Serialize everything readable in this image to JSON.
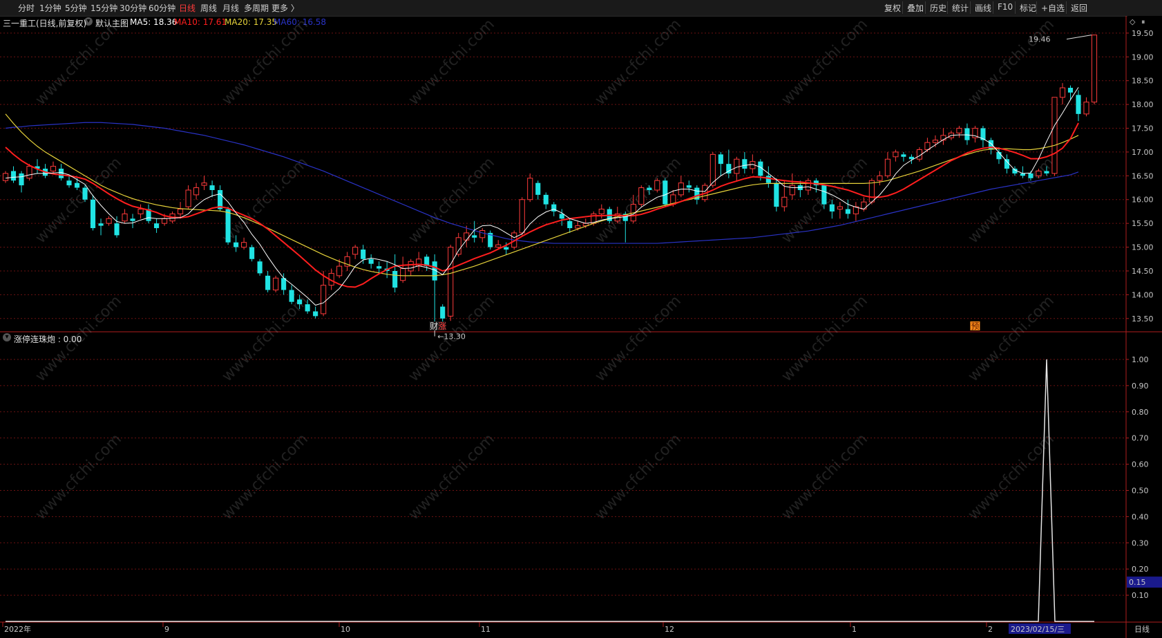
{
  "toolbar": {
    "left_items": [
      "分时",
      "1分钟",
      "5分钟",
      "15分钟",
      "30分钟",
      "60分钟",
      "日线",
      "周线",
      "月线",
      "多周期",
      "更多 〉"
    ],
    "active_item": "日线",
    "right_items": [
      "复权",
      "叠加",
      "历史",
      "统计",
      "画线",
      "F10",
      "标记",
      "+自选",
      "返回"
    ]
  },
  "main_header": {
    "stock": "三一重工(日线,前复权)",
    "template": "默认主图",
    "ma5": "MA5: 18.36",
    "ma10": "MA10: 17.61",
    "ma20": "MA20: 17.35",
    "ma60": "MA60: 16.58"
  },
  "indicator_header": {
    "label": "涨停连珠炮 : 0.00"
  },
  "price_axis": {
    "ticks": [
      "19.50",
      "19.00",
      "18.50",
      "18.00",
      "17.50",
      "17.00",
      "16.50",
      "16.00",
      "15.50",
      "15.00",
      "14.50",
      "14.00",
      "13.50"
    ]
  },
  "indicator_axis": {
    "ticks": [
      "1.00",
      "0.90",
      "0.80",
      "0.70",
      "0.60",
      "0.50",
      "0.40",
      "0.30",
      "0.20",
      "0.10"
    ],
    "current_value_badge": "0.15"
  },
  "time_axis": {
    "labels": [
      "2022年",
      "9",
      "10",
      "11",
      "12",
      "1",
      "2"
    ],
    "cursor_date": "2023/02/15/三",
    "period": "日线"
  },
  "annotations": {
    "high_label": "19.46",
    "low_label": "13.30",
    "event_cai": "财",
    "event_zhang": "涨",
    "event_yu": "预"
  },
  "watermark": "www.cfchi.com",
  "colors": {
    "up": "#ff3b3b",
    "down": "#20e3e3",
    "ma5": "#ffffff",
    "ma10": "#ff1e1e",
    "ma20": "#e6d23a",
    "ma60": "#2a33c8",
    "grid": "#6e1212",
    "axis_border": "#b01e1e"
  },
  "chart_data": {
    "type": "candlestick",
    "price_ylim": [
      13.25,
      19.6
    ],
    "indicator_ylim": [
      0,
      1.05
    ],
    "high": 19.46,
    "low": 13.3,
    "candles": [
      [
        16.4,
        16.55,
        16.35,
        16.6
      ],
      [
        16.6,
        16.4,
        16.35,
        16.7
      ],
      [
        16.55,
        16.3,
        16.15,
        16.6
      ],
      [
        16.45,
        16.7,
        16.4,
        16.75
      ],
      [
        16.7,
        16.65,
        16.55,
        16.85
      ],
      [
        16.65,
        16.5,
        16.45,
        16.75
      ],
      [
        16.6,
        16.7,
        16.55,
        16.8
      ],
      [
        16.65,
        16.45,
        16.4,
        16.75
      ],
      [
        16.4,
        16.3,
        16.25,
        16.5
      ],
      [
        16.35,
        16.25,
        16.2,
        16.45
      ],
      [
        16.25,
        16.0,
        15.95,
        16.3
      ],
      [
        16.0,
        15.4,
        15.35,
        16.1
      ],
      [
        15.5,
        15.45,
        15.25,
        15.6
      ],
      [
        15.5,
        15.6,
        15.45,
        15.65
      ],
      [
        15.5,
        15.25,
        15.2,
        15.65
      ],
      [
        15.55,
        15.7,
        15.5,
        15.8
      ],
      [
        15.6,
        15.55,
        15.4,
        15.7
      ],
      [
        15.7,
        15.8,
        15.6,
        15.9
      ],
      [
        15.8,
        15.55,
        15.5,
        15.9
      ],
      [
        15.5,
        15.4,
        15.3,
        15.6
      ],
      [
        15.5,
        15.6,
        15.45,
        15.7
      ],
      [
        15.55,
        15.7,
        15.5,
        15.75
      ],
      [
        15.7,
        15.8,
        15.6,
        15.95
      ],
      [
        15.85,
        16.2,
        15.8,
        16.3
      ],
      [
        16.1,
        16.25,
        16.0,
        16.35
      ],
      [
        16.3,
        16.35,
        16.2,
        16.5
      ],
      [
        16.3,
        16.2,
        16.05,
        16.4
      ],
      [
        16.2,
        15.8,
        15.75,
        16.3
      ],
      [
        15.8,
        15.1,
        15.05,
        15.85
      ],
      [
        15.1,
        15.0,
        14.9,
        15.25
      ],
      [
        15.0,
        15.1,
        14.95,
        15.2
      ],
      [
        15.0,
        14.75,
        14.7,
        15.05
      ],
      [
        14.7,
        14.45,
        14.4,
        14.75
      ],
      [
        14.4,
        14.1,
        14.05,
        14.5
      ],
      [
        14.1,
        14.35,
        14.05,
        14.4
      ],
      [
        14.35,
        14.1,
        14.0,
        14.45
      ],
      [
        14.1,
        13.85,
        13.8,
        14.2
      ],
      [
        13.9,
        13.8,
        13.7,
        14.0
      ],
      [
        13.8,
        13.65,
        13.6,
        13.9
      ],
      [
        13.65,
        13.55,
        13.5,
        13.75
      ],
      [
        13.6,
        14.2,
        13.55,
        14.5
      ],
      [
        14.2,
        14.45,
        14.1,
        14.55
      ],
      [
        14.4,
        14.6,
        14.35,
        14.75
      ],
      [
        14.6,
        14.8,
        14.5,
        14.9
      ],
      [
        14.85,
        15.0,
        14.75,
        15.05
      ],
      [
        14.95,
        14.75,
        14.65,
        15.05
      ],
      [
        14.75,
        14.65,
        14.55,
        14.85
      ],
      [
        14.6,
        14.55,
        14.45,
        14.7
      ],
      [
        14.55,
        14.5,
        14.35,
        14.7
      ],
      [
        14.5,
        14.15,
        14.05,
        14.85
      ],
      [
        14.3,
        14.55,
        14.25,
        14.8
      ],
      [
        14.5,
        14.7,
        14.4,
        14.75
      ],
      [
        14.6,
        14.75,
        14.5,
        14.9
      ],
      [
        14.8,
        14.6,
        14.5,
        14.85
      ],
      [
        14.7,
        14.3,
        13.3,
        14.85
      ],
      [
        13.75,
        13.5,
        13.3,
        13.8
      ],
      [
        13.55,
        15.0,
        13.45,
        15.05
      ],
      [
        14.85,
        15.2,
        14.8,
        15.3
      ],
      [
        15.15,
        15.3,
        15.0,
        15.45
      ],
      [
        15.25,
        15.2,
        15.1,
        15.55
      ],
      [
        15.2,
        15.35,
        15.1,
        15.4
      ],
      [
        15.3,
        15.0,
        14.95,
        15.35
      ],
      [
        15.0,
        15.05,
        14.95,
        15.15
      ],
      [
        15.0,
        14.95,
        14.85,
        15.1
      ],
      [
        15.0,
        15.3,
        14.95,
        15.35
      ],
      [
        15.3,
        16.0,
        15.25,
        16.05
      ],
      [
        16.0,
        16.45,
        15.95,
        16.55
      ],
      [
        16.35,
        16.1,
        16.0,
        16.4
      ],
      [
        16.1,
        15.9,
        15.8,
        16.15
      ],
      [
        15.9,
        15.75,
        15.65,
        15.95
      ],
      [
        15.7,
        15.6,
        15.45,
        15.8
      ],
      [
        15.55,
        15.4,
        15.3,
        15.6
      ],
      [
        15.4,
        15.45,
        15.35,
        15.55
      ],
      [
        15.45,
        15.5,
        15.4,
        15.6
      ],
      [
        15.5,
        15.7,
        15.45,
        15.75
      ],
      [
        15.7,
        15.8,
        15.6,
        15.9
      ],
      [
        15.8,
        15.55,
        15.5,
        15.85
      ],
      [
        15.55,
        15.7,
        15.5,
        15.85
      ],
      [
        15.7,
        15.55,
        15.1,
        15.75
      ],
      [
        15.55,
        15.9,
        15.5,
        16.1
      ],
      [
        15.9,
        16.25,
        15.85,
        16.3
      ],
      [
        16.25,
        16.2,
        16.1,
        16.3
      ],
      [
        16.2,
        16.4,
        16.15,
        16.45
      ],
      [
        16.4,
        15.9,
        15.85,
        16.45
      ],
      [
        15.9,
        16.1,
        15.85,
        16.2
      ],
      [
        16.1,
        16.35,
        16.05,
        16.5
      ],
      [
        16.3,
        16.25,
        16.15,
        16.4
      ],
      [
        16.25,
        16.0,
        15.9,
        16.3
      ],
      [
        16.0,
        16.3,
        15.95,
        16.35
      ],
      [
        16.3,
        16.95,
        16.25,
        17.0
      ],
      [
        16.95,
        16.75,
        16.5,
        17.0
      ],
      [
        16.75,
        16.55,
        16.45,
        17.05
      ],
      [
        16.55,
        16.85,
        16.4,
        16.9
      ],
      [
        16.85,
        16.65,
        16.55,
        17.0
      ],
      [
        16.65,
        16.8,
        16.55,
        16.95
      ],
      [
        16.8,
        16.5,
        16.4,
        16.85
      ],
      [
        16.5,
        16.35,
        16.25,
        16.7
      ],
      [
        16.35,
        15.85,
        15.75,
        16.45
      ],
      [
        15.85,
        16.05,
        15.75,
        16.4
      ],
      [
        16.1,
        16.3,
        16.0,
        16.55
      ],
      [
        16.3,
        16.2,
        16.05,
        16.4
      ],
      [
        16.2,
        16.4,
        16.1,
        16.45
      ],
      [
        16.4,
        16.3,
        16.15,
        16.45
      ],
      [
        16.3,
        15.9,
        15.8,
        16.3
      ],
      [
        15.9,
        15.75,
        15.6,
        16.0
      ],
      [
        15.8,
        15.85,
        15.6,
        15.95
      ],
      [
        15.8,
        15.7,
        15.6,
        16.0
      ],
      [
        15.7,
        15.85,
        15.55,
        15.95
      ],
      [
        15.8,
        15.95,
        15.75,
        16.05
      ],
      [
        15.95,
        16.4,
        15.9,
        16.45
      ],
      [
        16.4,
        16.5,
        16.3,
        16.6
      ],
      [
        16.5,
        16.85,
        16.45,
        17.0
      ],
      [
        16.9,
        17.0,
        16.8,
        17.05
      ],
      [
        16.95,
        16.9,
        16.8,
        17.0
      ],
      [
        16.9,
        16.85,
        16.75,
        16.95
      ],
      [
        16.85,
        17.05,
        16.8,
        17.1
      ],
      [
        17.05,
        17.2,
        17.0,
        17.3
      ],
      [
        17.2,
        17.25,
        17.1,
        17.35
      ],
      [
        17.25,
        17.35,
        17.15,
        17.5
      ],
      [
        17.3,
        17.4,
        17.25,
        17.45
      ],
      [
        17.4,
        17.5,
        17.3,
        17.55
      ],
      [
        17.5,
        17.25,
        17.15,
        17.6
      ],
      [
        17.3,
        17.5,
        17.2,
        17.55
      ],
      [
        17.5,
        17.25,
        17.1,
        17.55
      ],
      [
        17.25,
        17.05,
        16.95,
        17.3
      ],
      [
        17.0,
        16.85,
        16.75,
        17.1
      ],
      [
        16.85,
        16.65,
        16.55,
        16.95
      ],
      [
        16.65,
        16.55,
        16.5,
        16.7
      ],
      [
        16.55,
        16.5,
        16.45,
        16.7
      ],
      [
        16.55,
        16.45,
        16.4,
        16.6
      ],
      [
        16.5,
        16.6,
        16.45,
        16.65
      ],
      [
        16.6,
        16.55,
        16.5,
        16.7
      ],
      [
        16.55,
        18.15,
        16.5,
        18.15
      ],
      [
        18.15,
        18.35,
        18.0,
        18.45
      ],
      [
        18.35,
        18.25,
        18.1,
        18.4
      ],
      [
        18.2,
        17.8,
        17.65,
        18.3
      ],
      [
        17.8,
        18.05,
        17.75,
        18.15
      ],
      [
        18.05,
        19.46,
        18.0,
        19.46
      ]
    ],
    "ma5": [
      16.45,
      16.47,
      16.48,
      16.52,
      16.55,
      16.55,
      16.56,
      16.57,
      16.52,
      16.42,
      16.32,
      16.08,
      15.88,
      15.7,
      15.54,
      15.5,
      15.51,
      15.57,
      15.62,
      15.6,
      15.6,
      15.61,
      15.62,
      15.7,
      15.87,
      16.0,
      16.08,
      16.12,
      15.95,
      15.72,
      15.52,
      15.27,
      15.06,
      14.8,
      14.56,
      14.35,
      14.22,
      14.08,
      13.94,
      13.78,
      13.83,
      13.98,
      14.13,
      14.35,
      14.6,
      14.73,
      14.77,
      14.74,
      14.7,
      14.63,
      14.55,
      14.56,
      14.61,
      14.57,
      14.52,
      14.42,
      14.64,
      14.93,
      15.15,
      15.36,
      15.45,
      15.46,
      15.4,
      15.3,
      15.2,
      15.28,
      15.49,
      15.64,
      15.74,
      15.8,
      15.72,
      15.6,
      15.55,
      15.5,
      15.52,
      15.57,
      15.6,
      15.62,
      15.64,
      15.69,
      15.84,
      15.95,
      16.05,
      16.1,
      16.18,
      16.22,
      16.22,
      16.18,
      16.17,
      16.36,
      16.5,
      16.6,
      16.68,
      16.72,
      16.74,
      16.68,
      16.55,
      16.42,
      16.28,
      16.25,
      16.25,
      16.27,
      16.22,
      16.17,
      16.1,
      16.01,
      15.9,
      15.84,
      15.8,
      15.95,
      16.1,
      16.3,
      16.54,
      16.72,
      16.83,
      16.92,
      17.04,
      17.15,
      17.26,
      17.35,
      17.36,
      17.36,
      17.34,
      17.28,
      17.18,
      16.99,
      16.8,
      16.62,
      16.55,
      16.56,
      16.86,
      17.22,
      17.56,
      17.82,
      18.1,
      18.36
    ],
    "ma10": [
      17.1,
      16.95,
      16.82,
      16.72,
      16.64,
      16.58,
      16.54,
      16.52,
      16.5,
      16.47,
      16.43,
      16.34,
      16.23,
      16.12,
      16.02,
      15.93,
      15.86,
      15.82,
      15.78,
      15.73,
      15.66,
      15.63,
      15.62,
      15.64,
      15.7,
      15.76,
      15.82,
      15.85,
      15.82,
      15.74,
      15.67,
      15.6,
      15.5,
      15.38,
      15.24,
      15.1,
      14.96,
      14.82,
      14.67,
      14.52,
      14.4,
      14.3,
      14.22,
      14.17,
      14.16,
      14.23,
      14.34,
      14.44,
      14.53,
      14.6,
      14.62,
      14.63,
      14.64,
      14.62,
      14.58,
      14.5,
      14.55,
      14.62,
      14.69,
      14.76,
      14.82,
      14.88,
      14.96,
      15.04,
      15.13,
      15.23,
      15.32,
      15.4,
      15.47,
      15.52,
      15.57,
      15.6,
      15.62,
      15.64,
      15.66,
      15.66,
      15.67,
      15.67,
      15.66,
      15.66,
      15.69,
      15.74,
      15.8,
      15.85,
      15.9,
      15.96,
      16.02,
      16.08,
      16.13,
      16.2,
      16.28,
      16.34,
      16.39,
      16.44,
      16.48,
      16.47,
      16.45,
      16.42,
      16.4,
      16.38,
      16.37,
      16.35,
      16.33,
      16.31,
      16.28,
      16.24,
      16.2,
      16.14,
      16.08,
      16.05,
      16.05,
      16.08,
      16.14,
      16.22,
      16.32,
      16.42,
      16.52,
      16.62,
      16.72,
      16.82,
      16.9,
      16.98,
      17.04,
      17.08,
      17.1,
      17.08,
      17.04,
      16.99,
      16.93,
      16.86,
      16.86,
      16.9,
      16.97,
      17.08,
      17.28,
      17.61
    ],
    "ma20": [
      17.8,
      17.6,
      17.42,
      17.26,
      17.12,
      17.0,
      16.9,
      16.8,
      16.7,
      16.6,
      16.5,
      16.4,
      16.3,
      16.22,
      16.15,
      16.08,
      16.02,
      15.97,
      15.93,
      15.89,
      15.86,
      15.83,
      15.81,
      15.8,
      15.79,
      15.78,
      15.77,
      15.76,
      15.73,
      15.68,
      15.62,
      15.55,
      15.48,
      15.4,
      15.32,
      15.24,
      15.16,
      15.08,
      15.0,
      14.92,
      14.84,
      14.77,
      14.7,
      14.64,
      14.58,
      14.53,
      14.49,
      14.46,
      14.43,
      14.41,
      14.4,
      14.4,
      14.4,
      14.4,
      14.4,
      14.42,
      14.45,
      14.5,
      14.55,
      14.6,
      14.66,
      14.72,
      14.78,
      14.84,
      14.9,
      14.96,
      15.02,
      15.08,
      15.14,
      15.2,
      15.26,
      15.32,
      15.38,
      15.44,
      15.5,
      15.55,
      15.6,
      15.64,
      15.68,
      15.72,
      15.76,
      15.8,
      15.84,
      15.88,
      15.92,
      15.96,
      16.0,
      16.04,
      16.08,
      16.12,
      16.16,
      16.2,
      16.24,
      16.28,
      16.31,
      16.33,
      16.34,
      16.34,
      16.34,
      16.34,
      16.34,
      16.34,
      16.34,
      16.34,
      16.34,
      16.34,
      16.34,
      16.34,
      16.34,
      16.35,
      16.37,
      16.4,
      16.45,
      16.5,
      16.55,
      16.6,
      16.66,
      16.72,
      16.78,
      16.84,
      16.9,
      16.95,
      17.0,
      17.04,
      17.06,
      17.07,
      17.07,
      17.06,
      17.05,
      17.05,
      17.07,
      17.1,
      17.14,
      17.2,
      17.27,
      17.35
    ],
    "ma60": [
      17.5,
      17.52,
      17.53,
      17.55,
      17.56,
      17.57,
      17.58,
      17.59,
      17.6,
      17.61,
      17.62,
      17.62,
      17.62,
      17.61,
      17.6,
      17.59,
      17.58,
      17.56,
      17.54,
      17.52,
      17.5,
      17.47,
      17.44,
      17.41,
      17.38,
      17.35,
      17.31,
      17.27,
      17.23,
      17.19,
      17.15,
      17.1,
      17.05,
      17.0,
      16.95,
      16.9,
      16.84,
      16.78,
      16.72,
      16.66,
      16.6,
      16.53,
      16.46,
      16.39,
      16.32,
      16.25,
      16.18,
      16.11,
      16.04,
      15.97,
      15.9,
      15.83,
      15.76,
      15.69,
      15.62,
      15.56,
      15.5,
      15.45,
      15.4,
      15.35,
      15.3,
      15.26,
      15.22,
      15.18,
      15.15,
      15.13,
      15.11,
      15.1,
      15.09,
      15.08,
      15.08,
      15.08,
      15.08,
      15.08,
      15.08,
      15.08,
      15.08,
      15.08,
      15.08,
      15.08,
      15.08,
      15.08,
      15.08,
      15.09,
      15.1,
      15.11,
      15.12,
      15.13,
      15.14,
      15.15,
      15.16,
      15.17,
      15.18,
      15.19,
      15.2,
      15.22,
      15.24,
      15.26,
      15.28,
      15.3,
      15.32,
      15.34,
      15.37,
      15.4,
      15.43,
      15.46,
      15.5,
      15.54,
      15.58,
      15.62,
      15.66,
      15.7,
      15.74,
      15.78,
      15.82,
      15.86,
      15.9,
      15.94,
      15.98,
      16.02,
      16.06,
      16.1,
      16.14,
      16.18,
      16.22,
      16.25,
      16.28,
      16.31,
      16.34,
      16.37,
      16.4,
      16.43,
      16.46,
      16.49,
      16.52,
      16.58
    ],
    "indicator_series": {
      "name": "涨停连珠炮",
      "spike_index": 131,
      "spike_value": 1.0,
      "baseline": 0
    }
  }
}
